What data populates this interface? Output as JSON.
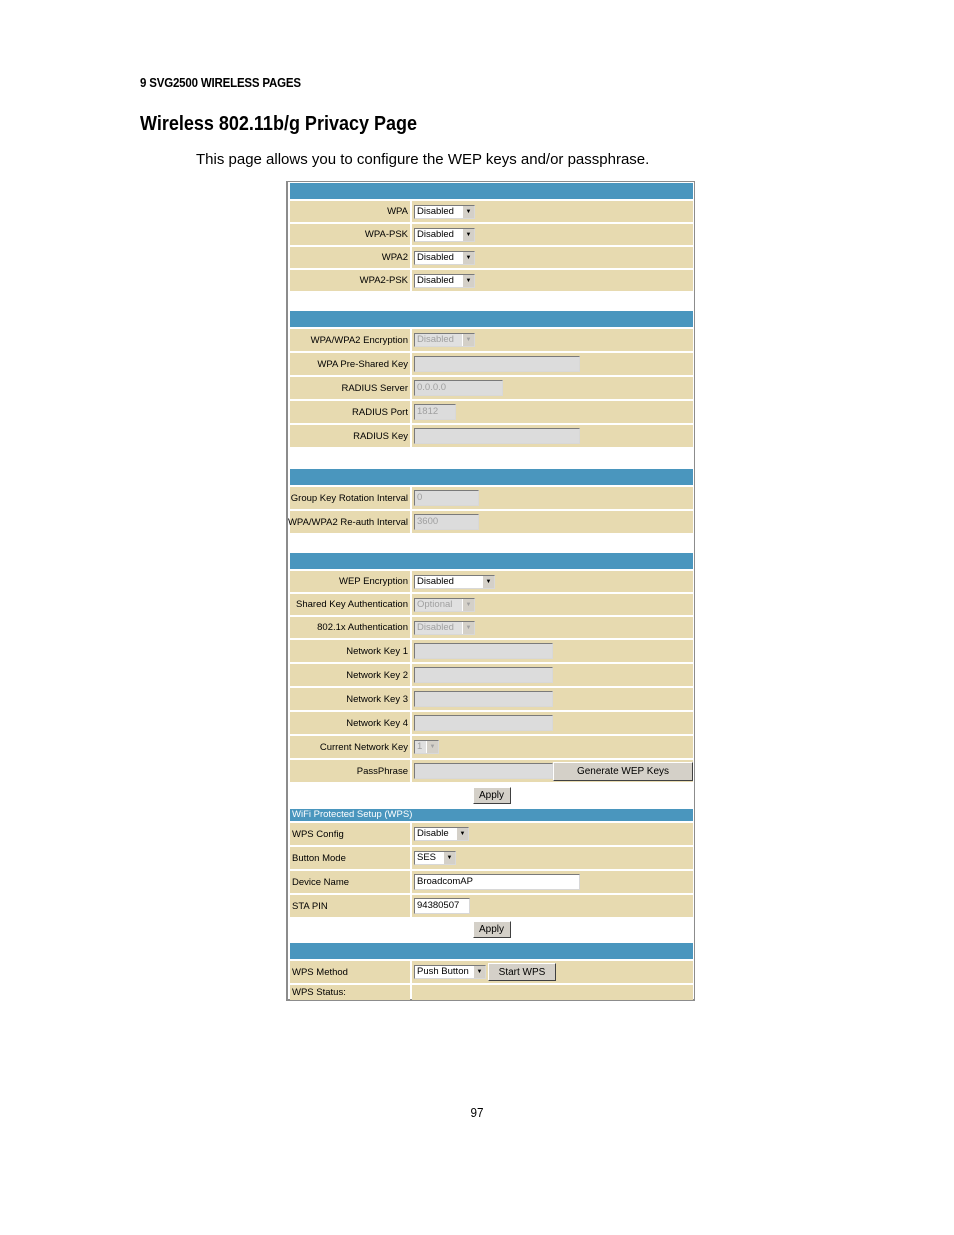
{
  "document": {
    "section_tag": "9 SVG2500 WIRELESS PAGES",
    "title": "Wireless 802.11b/g Privacy Page",
    "intro": "This page allows you to configure the WEP keys and/or passphrase.",
    "page_number": "97"
  },
  "colors": {
    "header_bar": "#4a96be",
    "row_background": "#e7dab0"
  },
  "wpa_modes": [
    {
      "label": "WPA",
      "value": "Disabled"
    },
    {
      "label": "WPA-PSK",
      "value": "Disabled"
    },
    {
      "label": "WPA2",
      "value": "Disabled"
    },
    {
      "label": "WPA2-PSK",
      "value": "Disabled"
    }
  ],
  "wpa_settings": {
    "encryption_label": "WPA/WPA2 Encryption",
    "encryption_value": "Disabled",
    "psk_label": "WPA Pre-Shared Key",
    "psk_value": "",
    "radius_server_label": "RADIUS Server",
    "radius_server_value": "0.0.0.0",
    "radius_port_label": "RADIUS Port",
    "radius_port_value": "1812",
    "radius_key_label": "RADIUS Key",
    "radius_key_value": ""
  },
  "intervals": {
    "group_key_label": "Group Key Rotation Interval",
    "group_key_value": "0",
    "reauth_label": "WPA/WPA2 Re-auth Interval",
    "reauth_value": "3600"
  },
  "wep": {
    "encryption_label": "WEP Encryption",
    "encryption_value": "Disabled",
    "shared_key_label": "Shared Key Authentication",
    "shared_key_value": "Optional",
    "dot1x_label": "802.1x Authentication",
    "dot1x_value": "Disabled",
    "keys": [
      {
        "label": "Network Key 1",
        "value": ""
      },
      {
        "label": "Network Key 2",
        "value": ""
      },
      {
        "label": "Network Key 3",
        "value": ""
      },
      {
        "label": "Network Key 4",
        "value": ""
      }
    ],
    "current_key_label": "Current Network Key",
    "current_key_value": "1",
    "passphrase_label": "PassPhrase",
    "passphrase_value": "",
    "generate_button": "Generate WEP Keys",
    "apply_button": "Apply"
  },
  "wps": {
    "header": "WiFi Protected Setup (WPS)",
    "config_label": "WPS Config",
    "config_value": "Disable",
    "button_mode_label": "Button Mode",
    "button_mode_value": "SES",
    "device_name_label": "Device Name",
    "device_name_value": "BroadcomAP",
    "sta_pin_label": "STA PIN",
    "sta_pin_value": "94380507",
    "apply_button": "Apply",
    "method_label": "WPS Method",
    "method_value": "Push Button",
    "start_button": "Start WPS",
    "status_label": "WPS Status:",
    "status_value": ""
  }
}
